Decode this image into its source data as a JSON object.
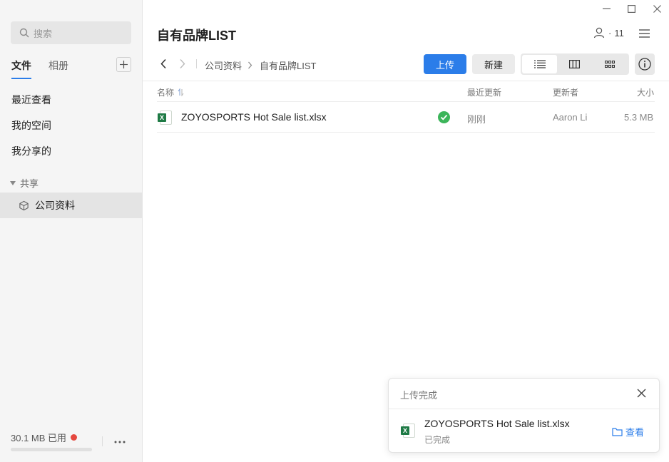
{
  "sidebar": {
    "search_placeholder": "搜索",
    "tabs": [
      {
        "label": "文件",
        "active": true
      },
      {
        "label": "相册",
        "active": false
      }
    ],
    "nav_items": [
      {
        "label": "最近查看"
      },
      {
        "label": "我的空间"
      },
      {
        "label": "我分享的"
      }
    ],
    "shared_section_label": "共享",
    "shared_items": [
      {
        "label": "公司资料",
        "selected": true
      }
    ],
    "storage_text": "30.1 MB 已用",
    "storage_used_fraction": 0.0,
    "more_icon": "ellipsis-icon"
  },
  "header": {
    "title": "自有品牌LIST",
    "members_count": "11"
  },
  "breadcrumb": {
    "items": [
      "公司资料",
      "自有品牌LIST"
    ]
  },
  "toolbar": {
    "upload_label": "上传",
    "new_label": "新建",
    "views": [
      "list-view-icon",
      "column-view-icon",
      "grid-view-icon"
    ],
    "active_view": "list-view-icon"
  },
  "table": {
    "columns": {
      "name": "名称",
      "modified": "最近更新",
      "updater": "更新者",
      "size": "大小"
    },
    "rows": [
      {
        "icon": "excel-file-icon",
        "name": "ZOYOSPORTS Hot Sale list.xlsx",
        "status_icon": "synced-check-icon",
        "modified": "刚刚",
        "updater": "Aaron Li",
        "size": "5.3 MB"
      }
    ]
  },
  "toast": {
    "title": "上传完成",
    "file_name": "ZOYOSPORTS Hot Sale list.xlsx",
    "status": "已完成",
    "view_label": "查看"
  },
  "colors": {
    "accent": "#2b7de9",
    "success": "#3cb55a",
    "error_dot": "#e5483f",
    "excel_green": "#1e7a45"
  }
}
